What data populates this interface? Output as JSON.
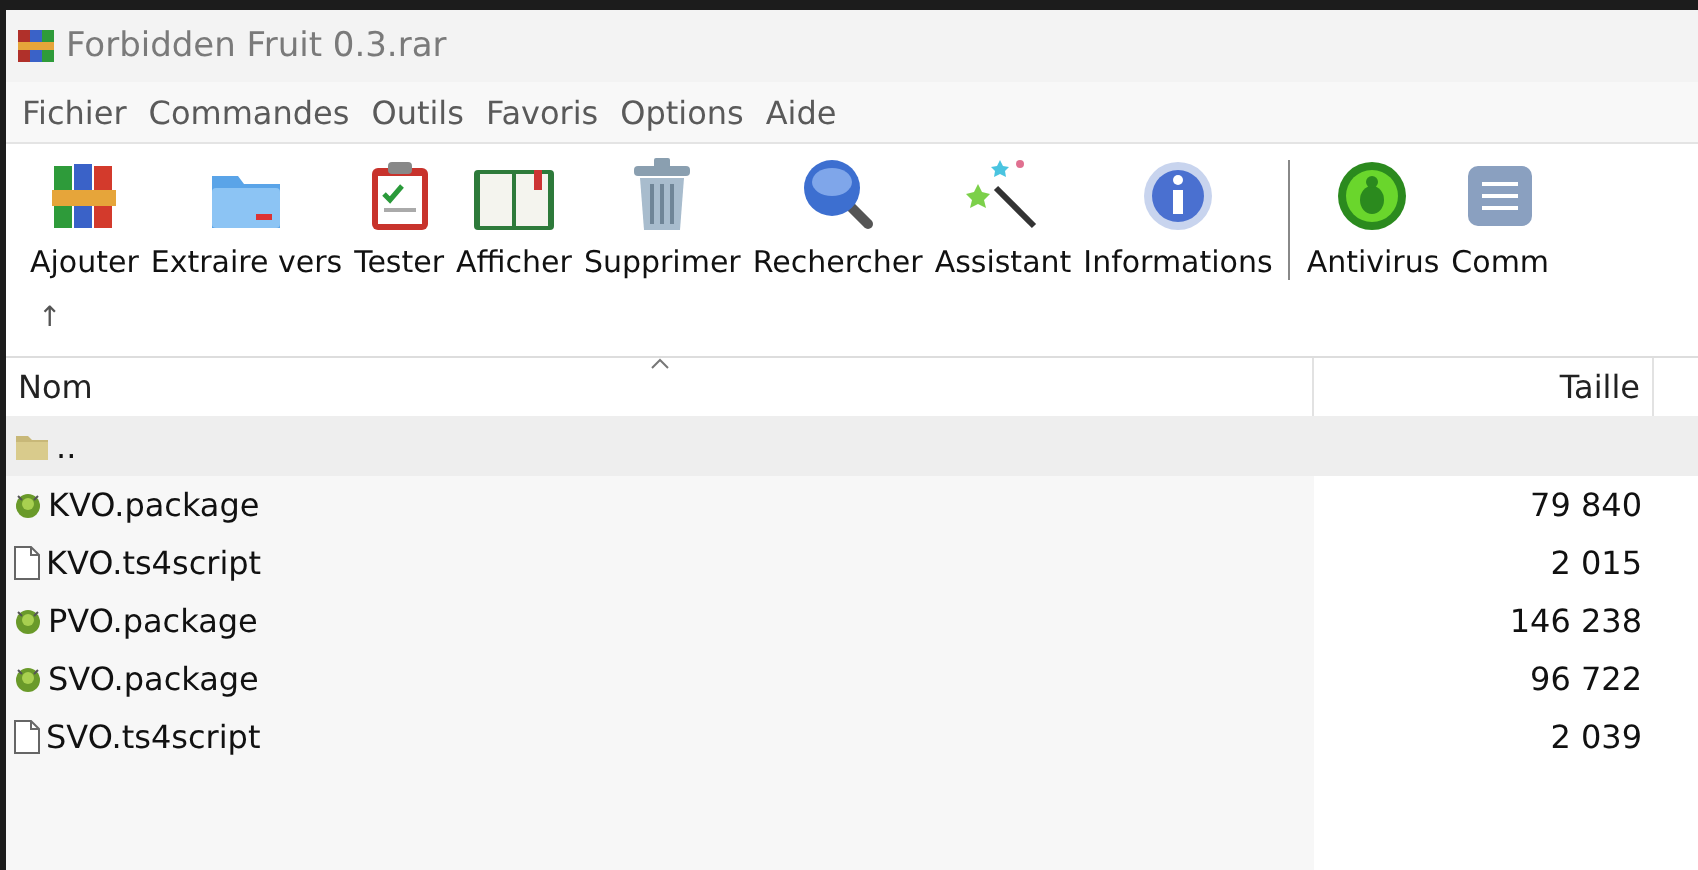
{
  "window": {
    "title": "Forbidden Fruit 0.3.rar"
  },
  "menu": [
    "Fichier",
    "Commandes",
    "Outils",
    "Favoris",
    "Options",
    "Aide"
  ],
  "toolbar": [
    {
      "kind": "button",
      "label": "Ajouter"
    },
    {
      "kind": "button",
      "label": "Extraire vers"
    },
    {
      "kind": "button",
      "label": "Tester"
    },
    {
      "kind": "button",
      "label": "Afficher"
    },
    {
      "kind": "button",
      "label": "Supprimer"
    },
    {
      "kind": "button",
      "label": "Rechercher"
    },
    {
      "kind": "button",
      "label": "Assistant"
    },
    {
      "kind": "button",
      "label": "Informations"
    },
    {
      "kind": "separator"
    },
    {
      "kind": "button",
      "label": "Antivirus"
    },
    {
      "kind": "button",
      "label": "Comm"
    }
  ],
  "up_button": {
    "label": "↑"
  },
  "table": {
    "columns": [
      "Nom",
      "Taille"
    ],
    "rows": [
      {
        "kind": "folder",
        "name": "..",
        "size": "",
        "selected": true
      },
      {
        "kind": "package",
        "name": "KVO.package",
        "size": "79 840",
        "selected": false
      },
      {
        "kind": "file",
        "name": "KVO.ts4script",
        "size": "2 015",
        "selected": false
      },
      {
        "kind": "package",
        "name": "PVO.package",
        "size": "146 238",
        "selected": false
      },
      {
        "kind": "package",
        "name": "SVO.package",
        "size": "96 722",
        "selected": false
      },
      {
        "kind": "file",
        "name": "SVO.ts4script",
        "size": "2 039",
        "selected": false
      }
    ]
  }
}
